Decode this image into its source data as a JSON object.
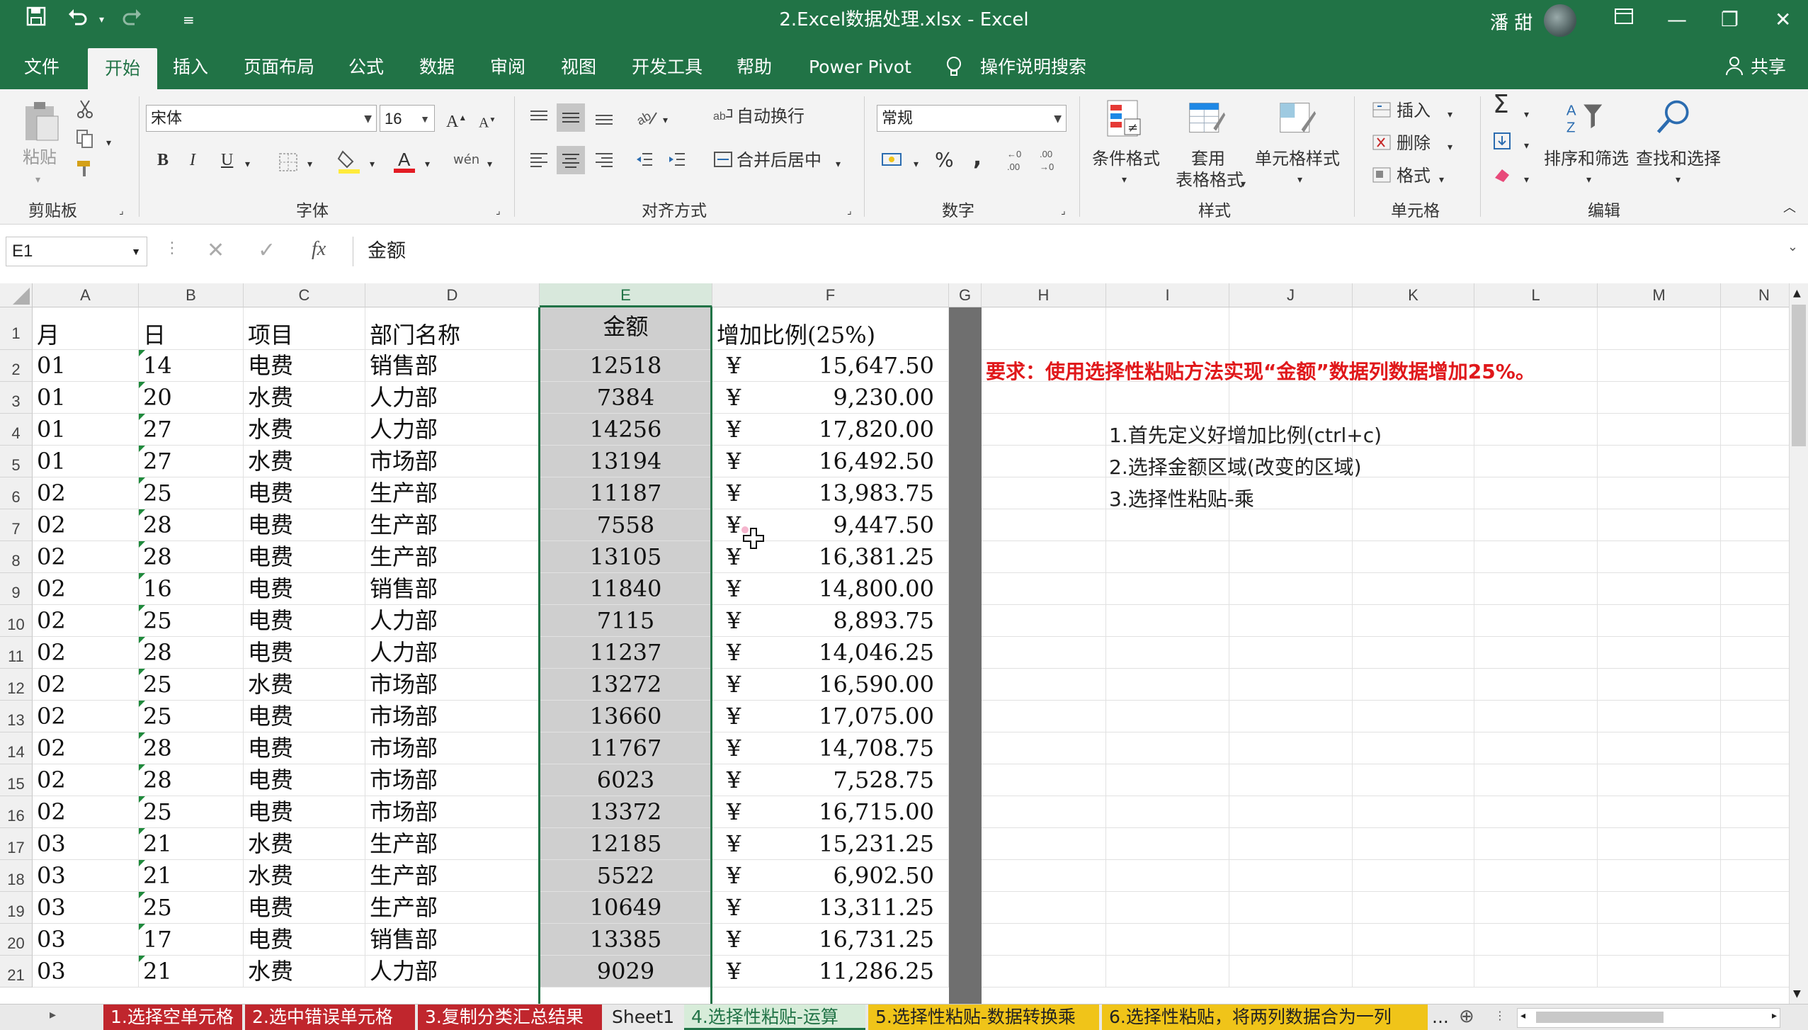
{
  "titlebar": {
    "title": "2.Excel数据处理.xlsx  -  Excel",
    "user": "潘 甜",
    "save_icon": "save-icon",
    "undo_icon": "undo-icon",
    "redo_icon": "redo-icon"
  },
  "tabs": [
    "文件",
    "开始",
    "插入",
    "页面布局",
    "公式",
    "数据",
    "审阅",
    "视图",
    "开发工具",
    "帮助",
    "Power Pivot",
    "操作说明搜索"
  ],
  "share_label": "共享",
  "ribbon": {
    "clipboard": {
      "label": "剪贴板",
      "paste": "粘贴"
    },
    "font": {
      "label": "字体",
      "name": "宋体",
      "size": "16",
      "bold": "B",
      "italic": "I",
      "underline": "U",
      "grow": "A",
      "shrink": "A",
      "wen": "wén"
    },
    "align": {
      "label": "对齐方式",
      "wrap": "自动换行",
      "merge": "合并后居中"
    },
    "number": {
      "label": "数字",
      "format": "常规",
      "percent": "%",
      "comma": ","
    },
    "styles": {
      "label": "样式",
      "cond": "条件格式",
      "table1": "套用",
      "table2": "表格格式",
      "cell": "单元格样式"
    },
    "cells": {
      "label": "单元格",
      "insert": "插入",
      "delete": "删除",
      "format": "格式"
    },
    "edit": {
      "label": "编辑",
      "sort": "排序和筛选",
      "find": "查找和选择"
    }
  },
  "formula_bar": {
    "name_box": "E1",
    "fx": "fx",
    "value": "金额"
  },
  "columns": [
    "A",
    "B",
    "C",
    "D",
    "E",
    "F",
    "G",
    "H",
    "I",
    "J",
    "K",
    "L",
    "M",
    "N"
  ],
  "header_row": {
    "A": "月",
    "B": "日",
    "C": "项目",
    "D": "部门名称",
    "E": "金额",
    "F": "增加比例(25%)"
  },
  "rows": [
    {
      "n": "2",
      "a": "01",
      "b": "14",
      "c": "电费",
      "d": "销售部",
      "e": "12518",
      "f": "15,647.50"
    },
    {
      "n": "3",
      "a": "01",
      "b": "20",
      "c": "水费",
      "d": "人力部",
      "e": "7384",
      "f": "9,230.00"
    },
    {
      "n": "4",
      "a": "01",
      "b": "27",
      "c": "水费",
      "d": "人力部",
      "e": "14256",
      "f": "17,820.00"
    },
    {
      "n": "5",
      "a": "01",
      "b": "27",
      "c": "水费",
      "d": "市场部",
      "e": "13194",
      "f": "16,492.50"
    },
    {
      "n": "6",
      "a": "02",
      "b": "25",
      "c": "电费",
      "d": "生产部",
      "e": "11187",
      "f": "13,983.75"
    },
    {
      "n": "7",
      "a": "02",
      "b": "28",
      "c": "电费",
      "d": "生产部",
      "e": "7558",
      "f": "9,447.50"
    },
    {
      "n": "8",
      "a": "02",
      "b": "28",
      "c": "电费",
      "d": "生产部",
      "e": "13105",
      "f": "16,381.25"
    },
    {
      "n": "9",
      "a": "02",
      "b": "16",
      "c": "电费",
      "d": "销售部",
      "e": "11840",
      "f": "14,800.00"
    },
    {
      "n": "10",
      "a": "02",
      "b": "25",
      "c": "电费",
      "d": "人力部",
      "e": "7115",
      "f": "8,893.75"
    },
    {
      "n": "11",
      "a": "02",
      "b": "28",
      "c": "电费",
      "d": "人力部",
      "e": "11237",
      "f": "14,046.25"
    },
    {
      "n": "12",
      "a": "02",
      "b": "25",
      "c": "水费",
      "d": "市场部",
      "e": "13272",
      "f": "16,590.00"
    },
    {
      "n": "13",
      "a": "02",
      "b": "25",
      "c": "电费",
      "d": "市场部",
      "e": "13660",
      "f": "17,075.00"
    },
    {
      "n": "14",
      "a": "02",
      "b": "28",
      "c": "电费",
      "d": "市场部",
      "e": "11767",
      "f": "14,708.75"
    },
    {
      "n": "15",
      "a": "02",
      "b": "28",
      "c": "电费",
      "d": "市场部",
      "e": "6023",
      "f": "7,528.75"
    },
    {
      "n": "16",
      "a": "02",
      "b": "25",
      "c": "电费",
      "d": "市场部",
      "e": "13372",
      "f": "16,715.00"
    },
    {
      "n": "17",
      "a": "03",
      "b": "21",
      "c": "水费",
      "d": "生产部",
      "e": "12185",
      "f": "15,231.25"
    },
    {
      "n": "18",
      "a": "03",
      "b": "21",
      "c": "水费",
      "d": "生产部",
      "e": "5522",
      "f": "6,902.50"
    },
    {
      "n": "19",
      "a": "03",
      "b": "25",
      "c": "电费",
      "d": "生产部",
      "e": "10649",
      "f": "13,311.25"
    },
    {
      "n": "20",
      "a": "03",
      "b": "17",
      "c": "电费",
      "d": "销售部",
      "e": "13385",
      "f": "16,731.25"
    },
    {
      "n": "21",
      "a": "03",
      "b": "21",
      "c": "水费",
      "d": "人力部",
      "e": "9029",
      "f": "11,286.25"
    }
  ],
  "currency": "¥",
  "notes": {
    "requirement": "要求：使用选择性粘贴方法实现“金额”数据列数据增加25%。",
    "steps": [
      "1.首先定义好增加比例(ctrl+c)",
      "2.选择金额区域(改变的区域)",
      "3.选择性粘贴-乘"
    ]
  },
  "sheet_tabs": [
    {
      "label": "1.选择空单元格",
      "color": "#c0262d",
      "text": "#ffffff"
    },
    {
      "label": "2.选中错误单元格",
      "color": "#c0262d",
      "text": "#ffffff"
    },
    {
      "label": "3.复制分类汇总结果",
      "color": "#c0262d",
      "text": "#ffffff"
    },
    {
      "label": "Sheet1",
      "color": "#e9e9e9",
      "text": "#222222"
    },
    {
      "label": "4.选择性粘贴-运算",
      "color": "#d7ecd9",
      "text": "#217346"
    },
    {
      "label": "5.选择性粘贴-数据转换乘",
      "color": "#f0c419",
      "text": "#222222"
    },
    {
      "label": "6.选择性粘贴，将两列数据合为一列",
      "color": "#f0c419",
      "text": "#222222"
    }
  ],
  "sheet_more": "..."
}
